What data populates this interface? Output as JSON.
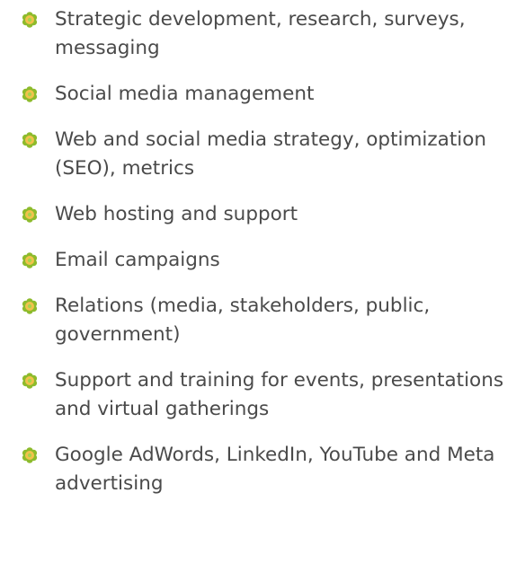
{
  "bullet": {
    "icon": "flower-bullet-icon",
    "color_outer": "#8dbb2c",
    "color_inner": "#f2c24c",
    "color_center": "#a8d44a"
  },
  "services": {
    "items": [
      {
        "label": "Strategic development, research, surveys, messaging"
      },
      {
        "label": "Social media management"
      },
      {
        "label": "Web and social media strategy, optimization (SEO), metrics"
      },
      {
        "label": "Web hosting and support"
      },
      {
        "label": "Email campaigns"
      },
      {
        "label": "Relations (media, stakeholders, public, government)"
      },
      {
        "label": "Support and training for events, presentations and virtual gatherings"
      },
      {
        "label": "Google AdWords, LinkedIn, YouTube and Meta advertising"
      }
    ]
  }
}
